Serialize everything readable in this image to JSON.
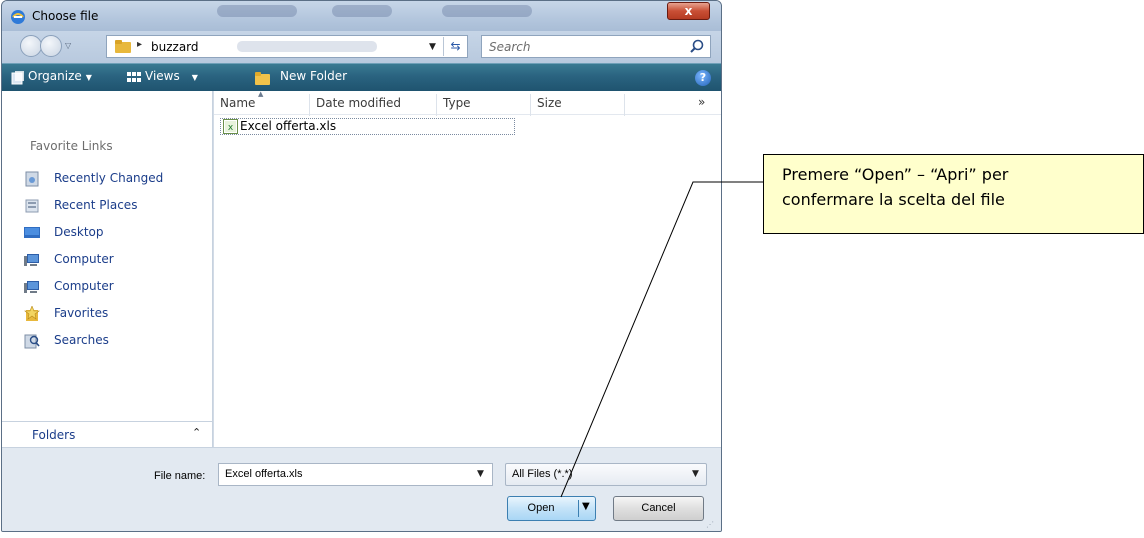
{
  "window": {
    "title": "Choose file",
    "close_label": "x"
  },
  "address": {
    "path": "buzzard",
    "search_placeholder": "Search"
  },
  "toolbar": {
    "organize_label": "Organize",
    "views_label": "Views",
    "new_folder_label": "New Folder",
    "help_label": "?"
  },
  "sidebar": {
    "heading": "Favorite Links",
    "items": [
      {
        "label": "Recently Changed",
        "icon": "recently-changed-icon"
      },
      {
        "label": "Recent Places",
        "icon": "recent-places-icon"
      },
      {
        "label": "Desktop",
        "icon": "desktop-icon"
      },
      {
        "label": "Computer",
        "icon": "computer-icon"
      },
      {
        "label": "Computer",
        "icon": "computer-icon"
      },
      {
        "label": "Favorites",
        "icon": "favorites-icon"
      },
      {
        "label": "Searches",
        "icon": "searches-icon"
      }
    ],
    "folders_label": "Folders"
  },
  "file_list": {
    "columns": [
      "Name",
      "Date modified",
      "Type",
      "Size"
    ],
    "more_columns": "»",
    "files": [
      {
        "name": "Excel offerta.xls",
        "icon": "excel-file-icon"
      }
    ]
  },
  "footer": {
    "file_name_label": "File name:",
    "file_name_value": "Excel offerta.xls",
    "filter_value": "All Files (*.*)",
    "open_label": "Open",
    "cancel_label": "Cancel"
  },
  "annotation": {
    "line1": "Premere “Open” – “Apri” per",
    "line2": "confermare la scelta del file"
  },
  "colors": {
    "toolbar": "#2a6380",
    "callout_bg": "#ffffcc",
    "link_text": "#1b3d8a"
  }
}
